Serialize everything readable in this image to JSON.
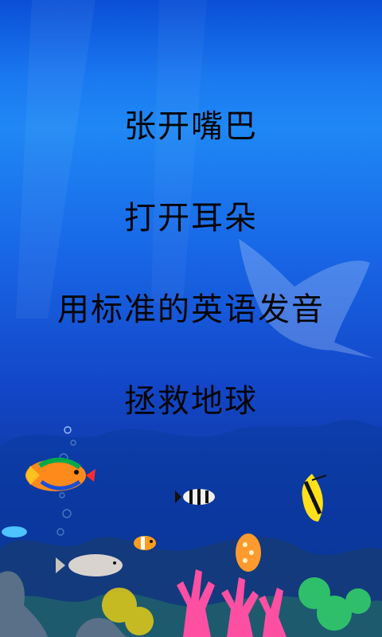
{
  "menu": {
    "items": [
      {
        "label": "张开嘴巴"
      },
      {
        "label": "打开耳朵"
      },
      {
        "label": "用标准的英语发音"
      },
      {
        "label": "拯救地球"
      }
    ]
  },
  "background": {
    "scene": "underwater-coral-reef",
    "colors": {
      "water_top": "#1f88f5",
      "water_bottom": "#0b2d86",
      "coral": "#ff4fa3"
    }
  }
}
